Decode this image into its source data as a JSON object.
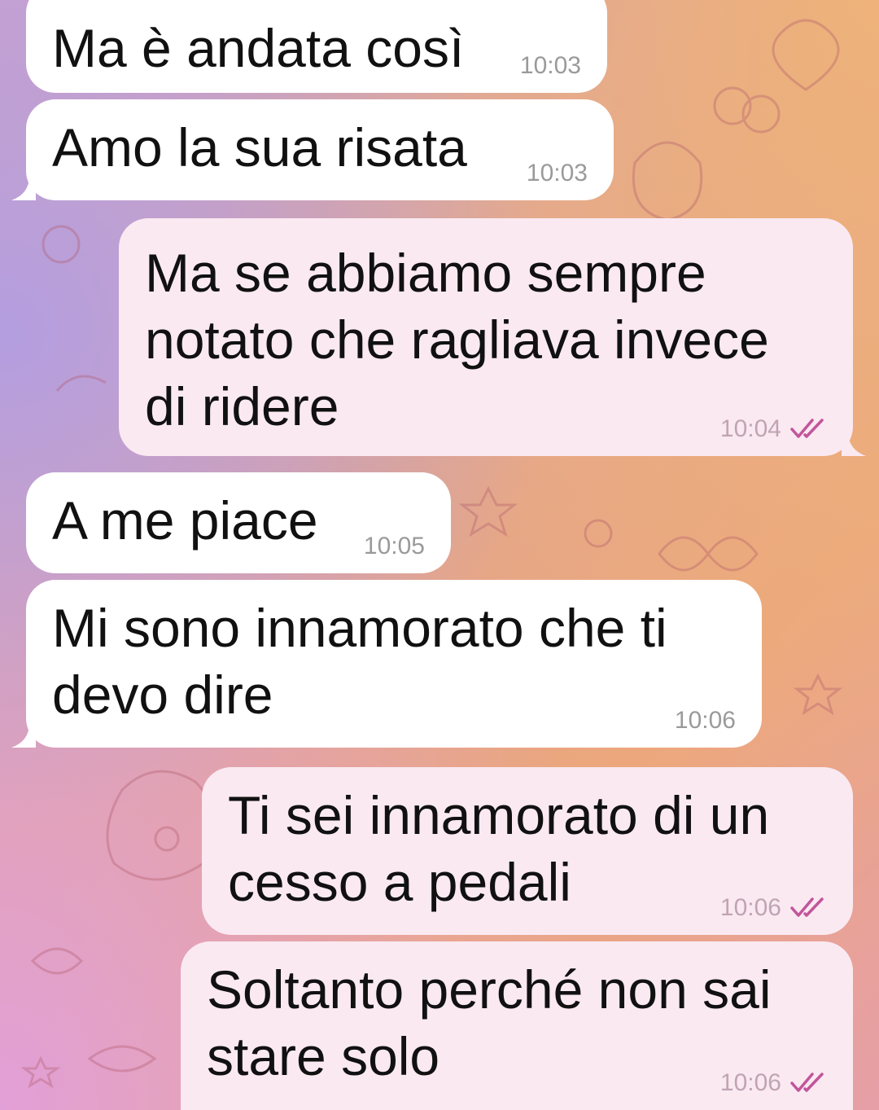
{
  "messages": [
    {
      "direction": "incoming",
      "text": "Ma è andata così",
      "time": "10:03"
    },
    {
      "direction": "incoming",
      "text": "Amo la sua risata",
      "time": "10:03"
    },
    {
      "direction": "outgoing",
      "text": "Ma se abbiamo sempre\nnotato che ragliava invece\ndi ridere",
      "time": "10:04",
      "read": true
    },
    {
      "direction": "incoming",
      "text": "A me piace",
      "time": "10:05"
    },
    {
      "direction": "incoming",
      "text": "Mi sono innamorato che ti\ndevo dire",
      "time": "10:06"
    },
    {
      "direction": "outgoing",
      "text": "Ti sei innamorato di un\ncesso a pedali",
      "time": "10:06",
      "read": true
    },
    {
      "direction": "outgoing",
      "text": "Soltanto perché non sai\nstare solo",
      "time": "10:06",
      "read": true
    }
  ],
  "colors": {
    "incoming_bubble": "#ffffff",
    "outgoing_bubble": "#fae9f1",
    "read_checks": "#c2559a"
  }
}
